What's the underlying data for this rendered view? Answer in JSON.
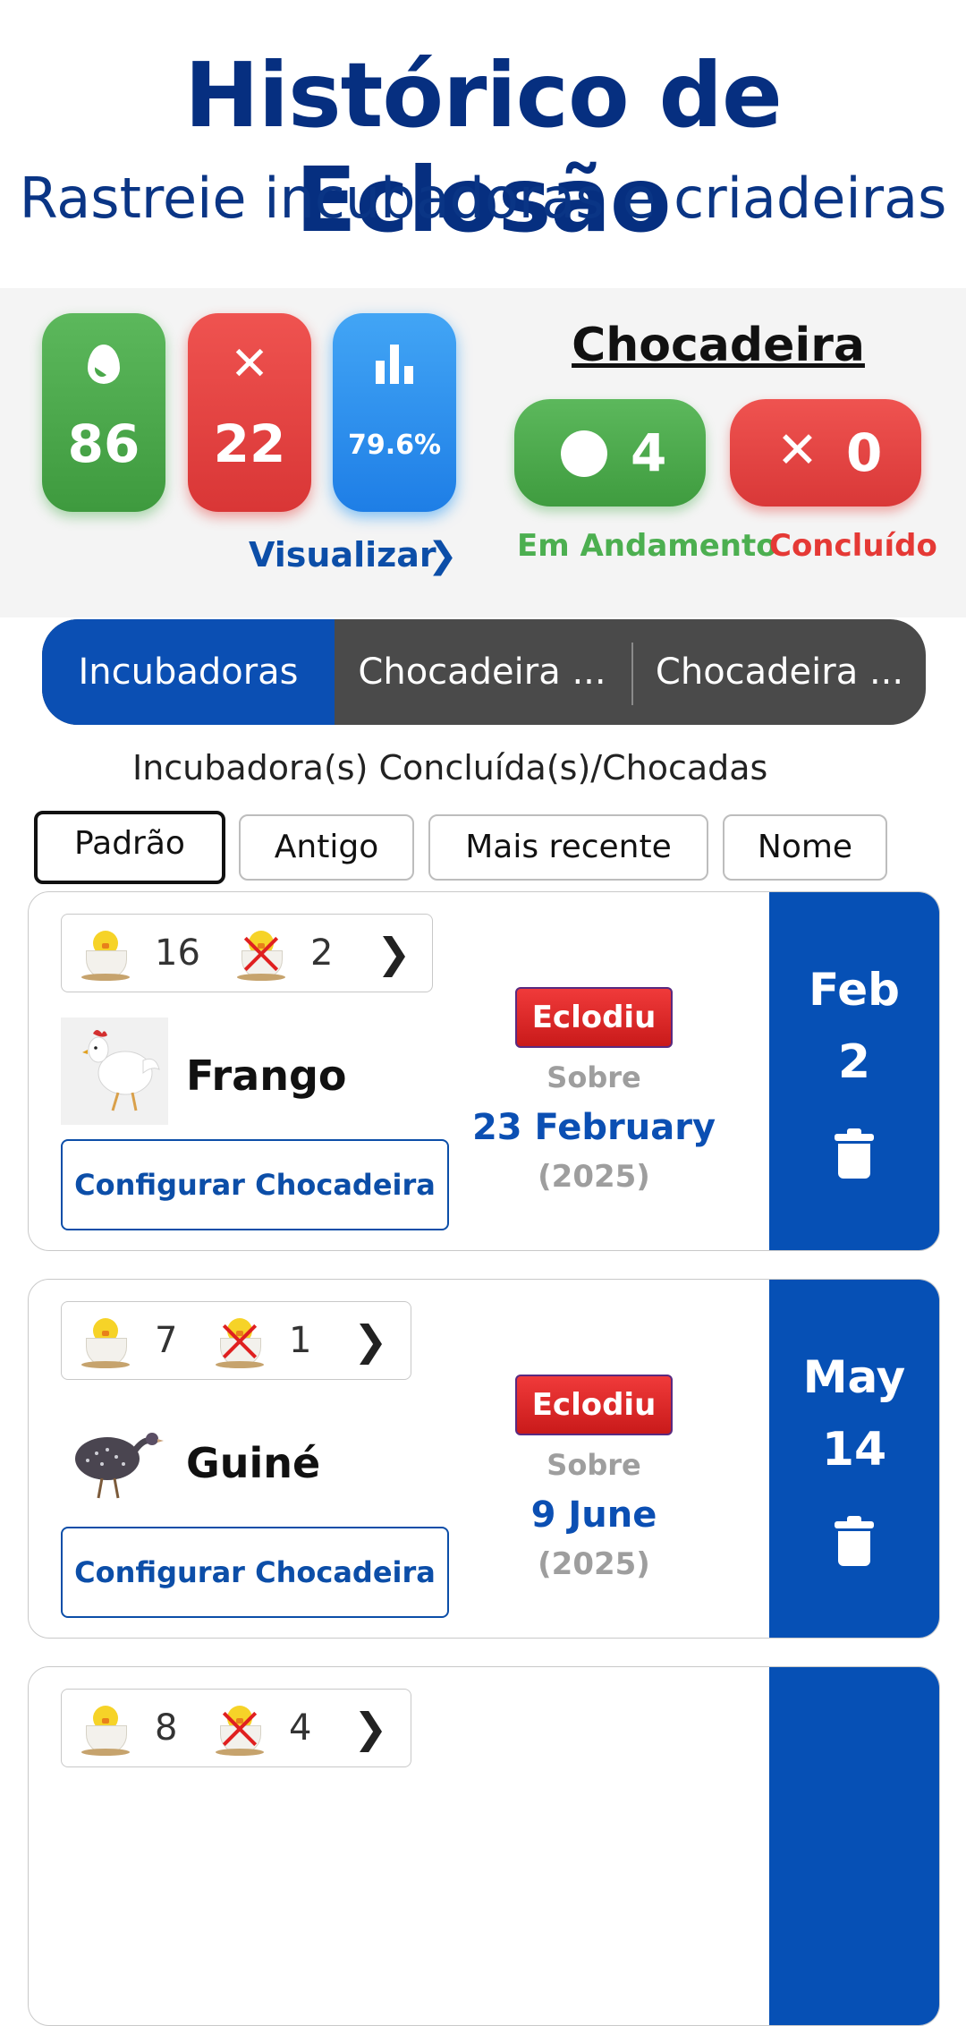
{
  "header": {
    "title": "Histórico de Eclosão",
    "subtitle": "Rastreie incubadoras e criadeiras"
  },
  "stats": {
    "hatched_count": "86",
    "failed_count": "22",
    "hatch_rate": "79.6%",
    "view_label": "Visualizar",
    "icons": [
      "egg-icon",
      "x-icon",
      "bar-chart-icon"
    ]
  },
  "brooder": {
    "title": "Chocadeira",
    "in_progress_count": "4",
    "completed_count": "0",
    "in_progress_label": "Em Andamento",
    "completed_label": "Concluído"
  },
  "tabs": [
    {
      "label": "Incubadoras",
      "active": true
    },
    {
      "label": "Chocadeira ...",
      "active": false
    },
    {
      "label": "Chocadeira ...",
      "active": false
    }
  ],
  "section_label": "Incubadora(s) Concluída(s)/Chocadas",
  "sort_options": [
    {
      "label": "Padrão",
      "active": true
    },
    {
      "label": "Antigo",
      "active": false
    },
    {
      "label": "Mais recente",
      "active": false
    },
    {
      "label": "Nome",
      "active": false
    }
  ],
  "cards": [
    {
      "hatched": "16",
      "failed": "2",
      "bird_name": "Frango",
      "config_label": "Configurar Chocadeira →",
      "status": "Eclodiu",
      "about_label": "Sobre",
      "hatch_date": "23 February",
      "hatch_year": "(2025)",
      "start_month": "Feb",
      "start_day": "2"
    },
    {
      "hatched": "7",
      "failed": "1",
      "bird_name": "Guiné",
      "config_label": "Configurar Chocadeira →",
      "status": "Eclodiu",
      "about_label": "Sobre",
      "hatch_date": "9 June",
      "hatch_year": "(2025)",
      "start_month": "May",
      "start_day": "14"
    },
    {
      "hatched": "8",
      "failed": "4"
    }
  ],
  "colors": {
    "primary_blue": "#0650b5",
    "title_navy": "#062f80",
    "success_green": "#4caf50",
    "danger_red": "#e53935",
    "stat_blue": "#1e88e5"
  }
}
